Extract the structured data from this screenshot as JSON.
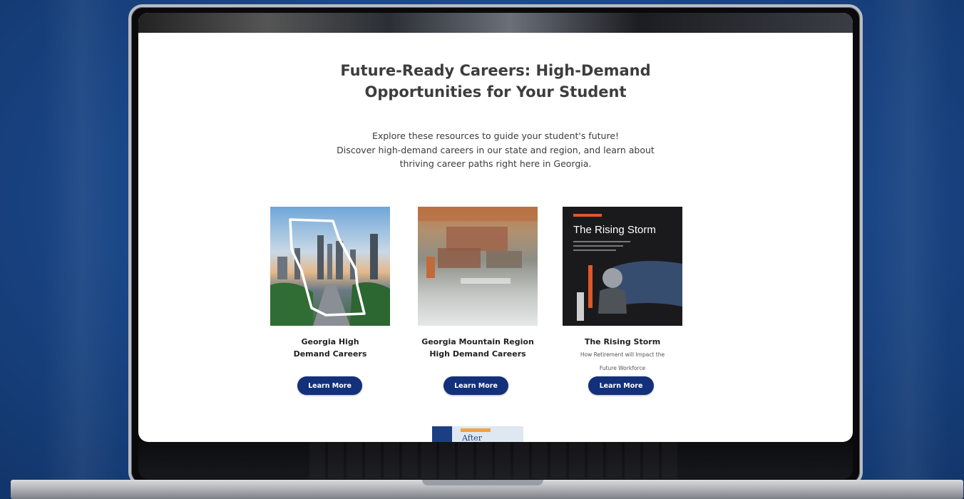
{
  "page": {
    "title_line1": "Future-Ready Careers: High-Demand",
    "title_line2": "Opportunities for Your Student",
    "intro_line1": "Explore these resources to guide your student's future!",
    "intro_line2": "Discover high-demand careers in our state and region, and learn about",
    "intro_line3": "thriving career paths right here in Georgia."
  },
  "cards": [
    {
      "title_line1": "Georgia High",
      "title_line2": "Demand Careers",
      "button": "Learn More"
    },
    {
      "title_line1": "Georgia Mountain Region",
      "title_line2": "High Demand Careers",
      "button": "Learn More"
    },
    {
      "title_line1": "The Rising Storm",
      "subtitle_line1": "How Retirement will Impact the",
      "subtitle_line2": "Future Workforce",
      "button": "Learn More",
      "image_title": "The Rising Storm"
    }
  ],
  "teaser": {
    "text": "After"
  },
  "colors": {
    "button": "#13307a",
    "background": "#1b4a8c"
  }
}
